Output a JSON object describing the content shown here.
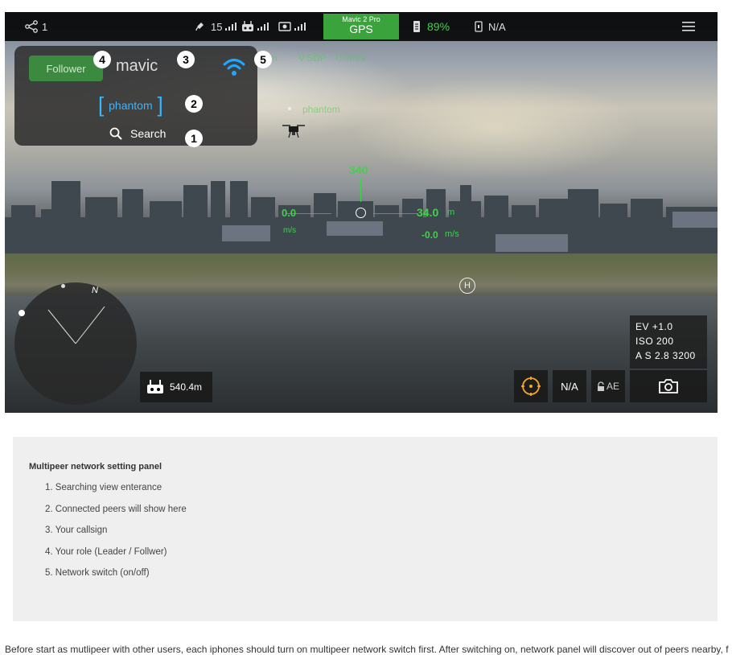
{
  "topbar": {
    "share_count": "1",
    "sat_count": "15",
    "drone_model": "Mavic 2 Pro",
    "mode": "GPS",
    "battery": "89%",
    "device_status": "N/A"
  },
  "panel": {
    "role": "Follower",
    "callsign": "mavic",
    "peer_open": "[",
    "peer_name": "phantom",
    "peer_close": "]",
    "search_label": "Search",
    "badges": [
      "1",
      "2",
      "3",
      "4",
      "5"
    ]
  },
  "telemetry": {
    "alt_ghost": "0m",
    "vsdp_ghost": "V.SDP",
    "vs_ghost": "-0.0m/s",
    "peer_ghost": "phantom",
    "heading": "340",
    "hspeed": "0.0",
    "hspeed_unit": "m/s",
    "altitude": "34.0",
    "altitude_unit": "m",
    "vspeed": "-0.0",
    "vspeed_unit": "m/s",
    "home_marker": "H"
  },
  "radar": {
    "north": "N"
  },
  "camera": {
    "ev": "EV  +1.0",
    "iso": "ISO 200",
    "aperture": "A S  2.8  3200",
    "rc_distance": "540.4m",
    "focus_na": "N/A",
    "ae_lock": "AE"
  },
  "notes": {
    "title": "Multipeer network setting panel",
    "items": [
      "1.  Searching view enterance",
      "2.  Connected peers will show here",
      "3.  Your callsign",
      "4.  Your role (Leader / Follwer)",
      "5.  Network switch (on/off)"
    ]
  },
  "paragraph": "Before start as mutlipeer with other users, each iphones should turn on multipeer network switch first. After switching on, network panel will discover out of peers nearby, find and"
}
